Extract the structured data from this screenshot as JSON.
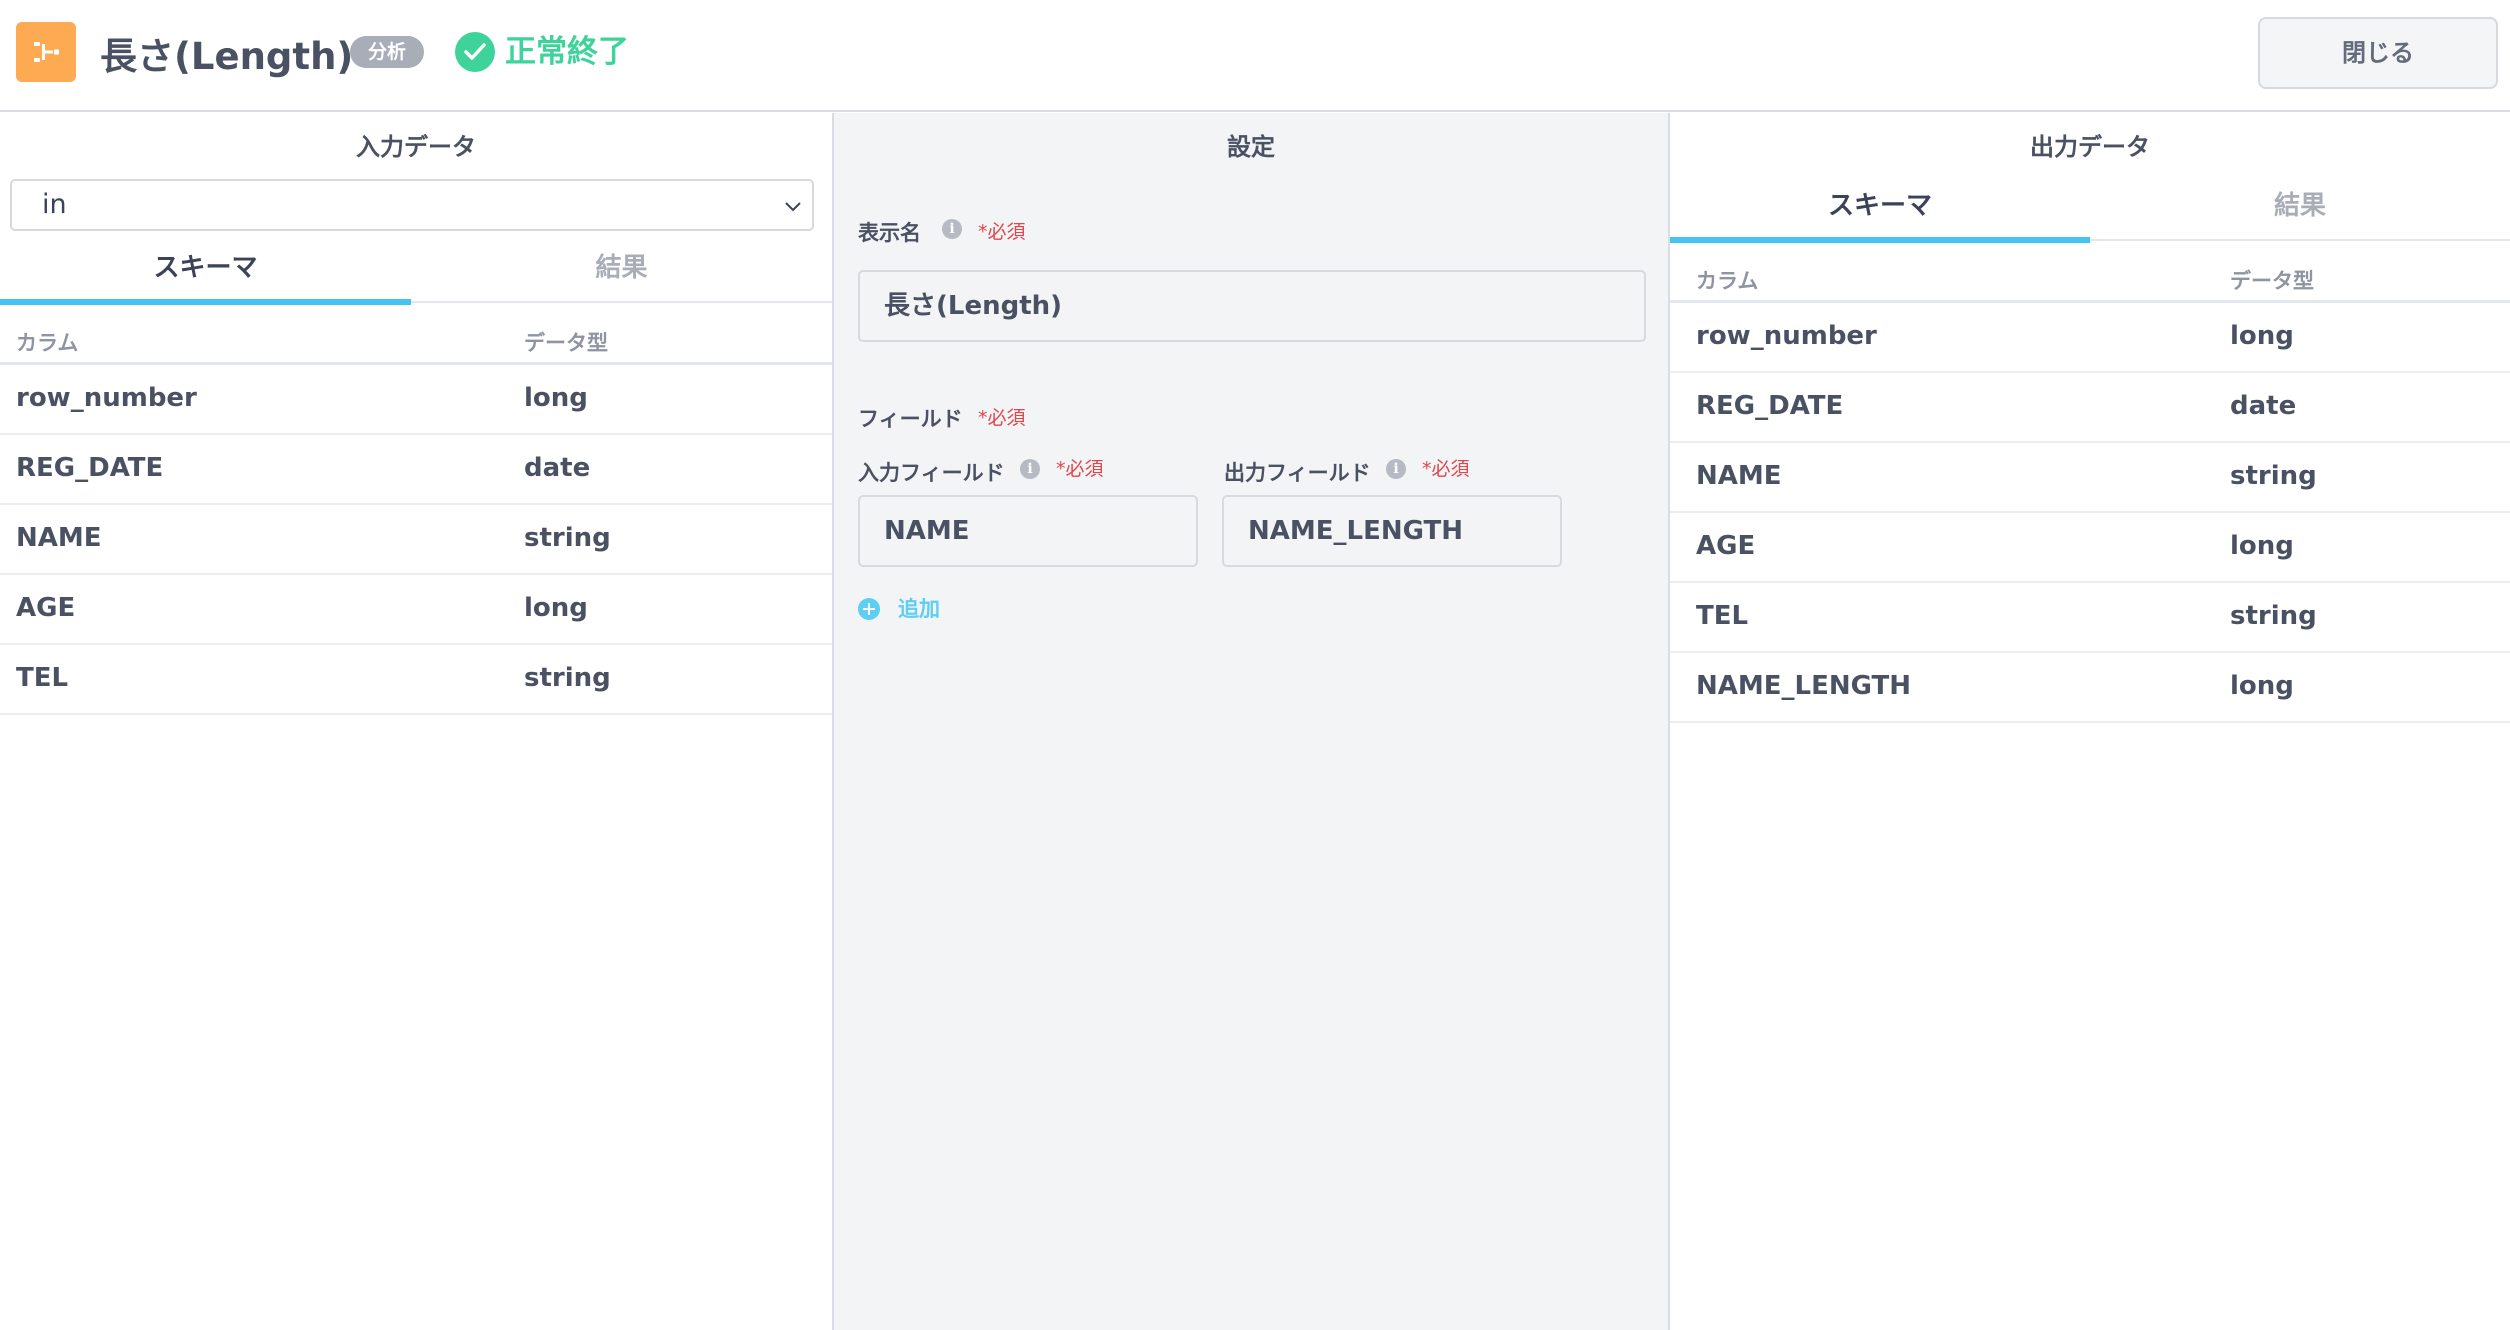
{
  "header": {
    "title": "長さ(Length)",
    "badge": "分析",
    "status": "正常終了",
    "close_label": "閉じる",
    "icon_color": "#fdaa52",
    "status_color": "#3ed39a"
  },
  "input_panel": {
    "title": "入力データ",
    "select_value": "in",
    "tabs": [
      "スキーマ",
      "結果"
    ],
    "active_tab": "スキーマ",
    "columns": [
      "カラム",
      "データ型"
    ],
    "rows": [
      {
        "column": "row_number",
        "type": "long"
      },
      {
        "column": "REG_DATE",
        "type": "date"
      },
      {
        "column": "NAME",
        "type": "string"
      },
      {
        "column": "AGE",
        "type": "long"
      },
      {
        "column": "TEL",
        "type": "string"
      }
    ]
  },
  "settings_panel": {
    "title": "設定",
    "display_name_label": "表示名",
    "required_label": "*必須",
    "display_name_value": "長さ(Length)",
    "fields_label": "フィールド",
    "input_field_label": "入力フィールド",
    "output_field_label": "出力フィールド",
    "input_field_value": "NAME",
    "output_field_value": "NAME_LENGTH",
    "add_label": "追加"
  },
  "output_panel": {
    "title": "出力データ",
    "tabs": [
      "スキーマ",
      "結果"
    ],
    "active_tab": "スキーマ",
    "columns": [
      "カラム",
      "データ型"
    ],
    "rows": [
      {
        "column": "row_number",
        "type": "long"
      },
      {
        "column": "REG_DATE",
        "type": "date"
      },
      {
        "column": "NAME",
        "type": "string"
      },
      {
        "column": "AGE",
        "type": "long"
      },
      {
        "column": "TEL",
        "type": "string"
      },
      {
        "column": "NAME_LENGTH",
        "type": "long"
      }
    ]
  }
}
